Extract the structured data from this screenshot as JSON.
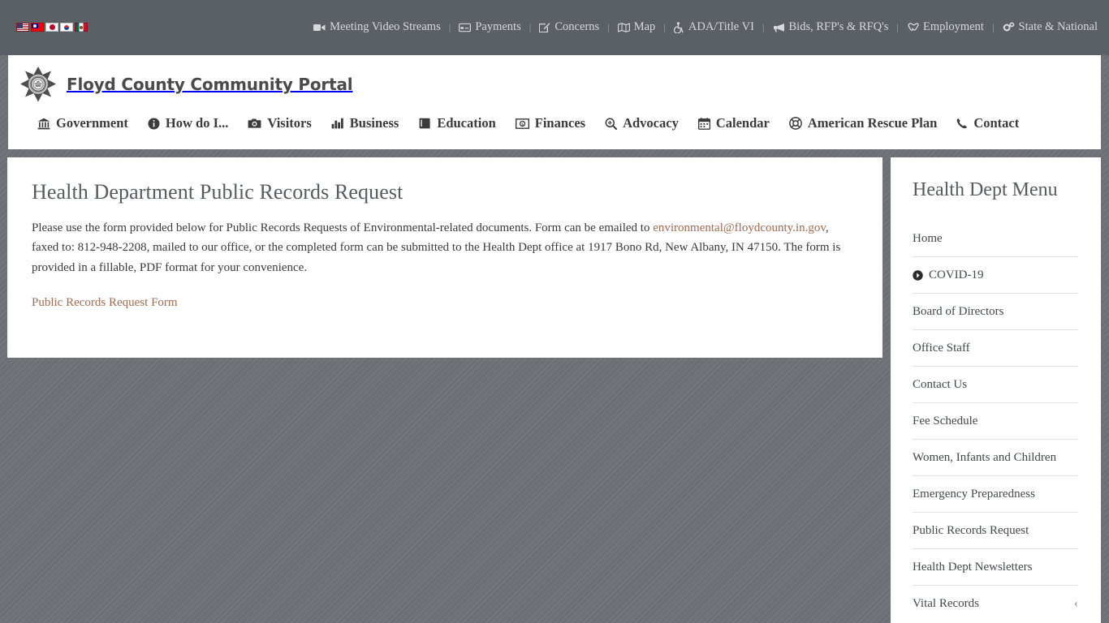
{
  "topbar": {
    "flags": [
      {
        "name": "flag-united-states",
        "label": "English"
      },
      {
        "name": "flag-taiwan",
        "label": "Chinese"
      },
      {
        "name": "flag-japan",
        "label": "Japanese"
      },
      {
        "name": "flag-south-korea",
        "label": "Korean"
      },
      {
        "name": "flag-mexico",
        "label": "Spanish"
      }
    ],
    "links": [
      {
        "label": "Meeting Video Streams",
        "icon": "video-camera-icon"
      },
      {
        "label": "Payments",
        "icon": "credit-card-icon"
      },
      {
        "label": "Concerns",
        "icon": "pencil-square-icon"
      },
      {
        "label": "Map",
        "icon": "map-icon"
      },
      {
        "label": "ADA/Title VI",
        "icon": "wheelchair-icon"
      },
      {
        "label": "Bids, RFP's & RFQ's",
        "icon": "bullhorn-icon"
      },
      {
        "label": "Employment",
        "icon": "handshake-icon"
      },
      {
        "label": "State & National",
        "icon": "cogs-icon"
      }
    ],
    "separator": "|"
  },
  "header": {
    "logo_icon": "county-seal-logo",
    "site_title": "Floyd County Community Portal",
    "nav": [
      {
        "label": "Government",
        "icon": "bank-icon"
      },
      {
        "label": "How do I...",
        "icon": "info-circle-icon"
      },
      {
        "label": "Visitors",
        "icon": "camera-icon"
      },
      {
        "label": "Business",
        "icon": "bar-chart-icon"
      },
      {
        "label": "Education",
        "icon": "book-icon"
      },
      {
        "label": "Finances",
        "icon": "money-icon"
      },
      {
        "label": "Advocacy",
        "icon": "search-plus-icon"
      },
      {
        "label": "Calendar",
        "icon": "calendar-icon"
      },
      {
        "label": "American Rescue Plan",
        "icon": "life-ring-icon"
      },
      {
        "label": "Contact",
        "icon": "phone-icon"
      }
    ]
  },
  "main": {
    "title": "Health Department Public Records Request",
    "paragraph_part1": "Please use the form provided below for Public Records Requests of Environmental-related documents. Form can be emailed to ",
    "email_link": "environmental@floydcounty.in.gov",
    "paragraph_part2": ", faxed to: 812-948-2208, mailed to our office, or the completed form can be submitted to the Health Dept office at 1917 Bono Rd, New Albany, IN 47150. The form is provided in a fillable, PDF format for your convenience.",
    "form_link": "Public Records Request Form"
  },
  "sidebar": {
    "title": "Health Dept Menu",
    "items": [
      {
        "label": "Home",
        "icon": null,
        "chevron": null
      },
      {
        "label": "COVID-19",
        "icon": "arrow-circle-right-icon",
        "chevron": null
      },
      {
        "label": "Board of Directors",
        "icon": null,
        "chevron": null
      },
      {
        "label": "Office Staff",
        "icon": null,
        "chevron": null
      },
      {
        "label": "Contact Us",
        "icon": null,
        "chevron": null
      },
      {
        "label": "Fee Schedule",
        "icon": null,
        "chevron": null
      },
      {
        "label": "Women, Infants and Children",
        "icon": null,
        "chevron": null
      },
      {
        "label": "Emergency Preparedness",
        "icon": null,
        "chevron": null
      },
      {
        "label": "Public Records Request",
        "icon": null,
        "chevron": null
      },
      {
        "label": "Health Dept Newsletters",
        "icon": null,
        "chevron": null
      },
      {
        "label": "Vital Records",
        "icon": null,
        "chevron": "‹"
      }
    ]
  },
  "colors": {
    "page_background": "#6e7277",
    "topbar_background": "#5b5f66",
    "panel_background": "#ffffff",
    "link_accent": "#a26a52",
    "heading_text": "#565b60",
    "body_text": "#3a3a3a"
  }
}
